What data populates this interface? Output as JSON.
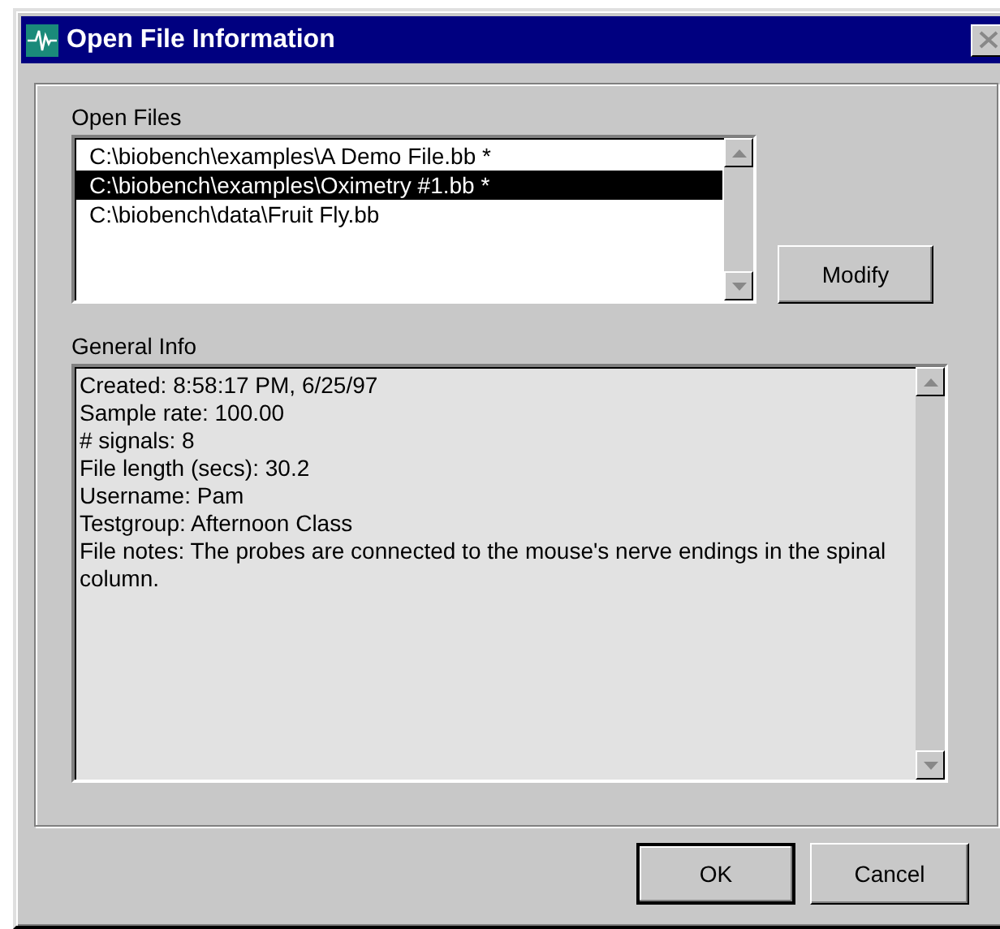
{
  "window": {
    "title": "Open File Information"
  },
  "open_files": {
    "label": "Open Files",
    "items": [
      {
        "path": "C:\\biobench\\examples\\A Demo File.bb *",
        "selected": false
      },
      {
        "path": "C:\\biobench\\examples\\Oximetry #1.bb *",
        "selected": true
      },
      {
        "path": "C:\\biobench\\data\\Fruit Fly.bb",
        "selected": false
      }
    ]
  },
  "modify_button": "Modify",
  "general_info": {
    "label": "General Info",
    "lines": [
      "Created: 8:58:17 PM, 6/25/97",
      "Sample rate: 100.00",
      "# signals: 8",
      "File length (secs): 30.2",
      "Username: Pam",
      "Testgroup: Afternoon Class",
      "File notes: The probes are connected to the mouse's nerve endings in the spinal column."
    ]
  },
  "buttons": [
    "OK",
    "Cancel"
  ]
}
